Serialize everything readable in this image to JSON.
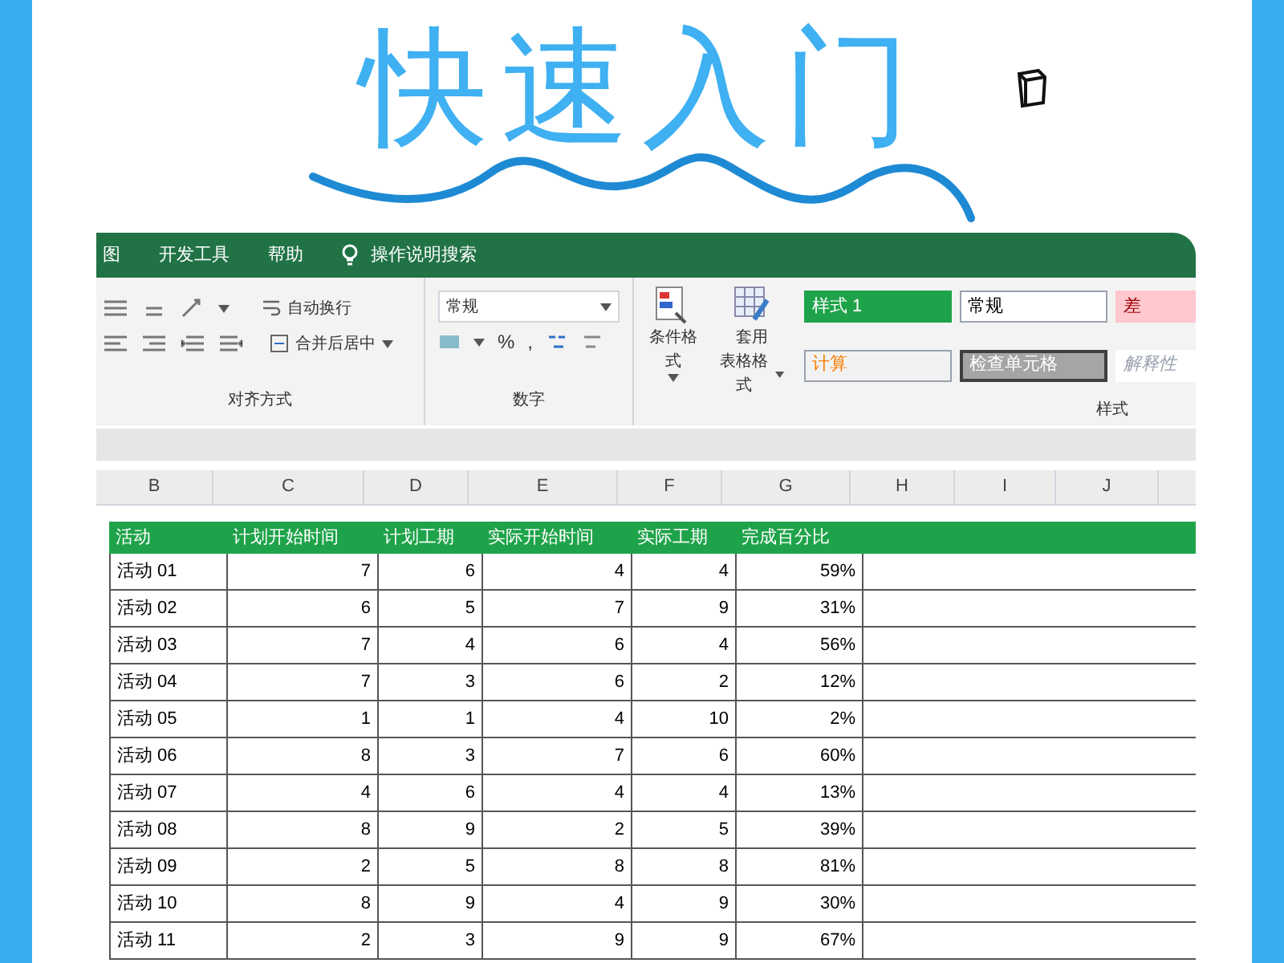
{
  "title": "快速入门",
  "ribbon_tabs": [
    "图",
    "开发工具",
    "帮助"
  ],
  "tell_me": "操作说明搜索",
  "alignment": {
    "wrap_text": "自动换行",
    "merge": "合并后居中",
    "label": "对齐方式"
  },
  "number": {
    "format": "常规",
    "symbols": [
      "%",
      ","
    ],
    "label": "数字"
  },
  "styles": {
    "conditional": "条件格式",
    "table_format": [
      "套用",
      "表格格式"
    ],
    "label": "样式",
    "cells": [
      {
        "text": "样式 1",
        "kind": "green"
      },
      {
        "text": "常规",
        "kind": "normal"
      },
      {
        "text": "差",
        "kind": "bad"
      },
      {
        "text": "计算",
        "kind": "calc"
      },
      {
        "text": "检查单元格",
        "kind": "check"
      },
      {
        "text": "解释性",
        "kind": "note"
      }
    ]
  },
  "column_letters": [
    "B",
    "C",
    "D",
    "E",
    "F",
    "G",
    "H",
    "I",
    "J"
  ],
  "table": {
    "columns": [
      "活动",
      "计划开始时间",
      "计划工期",
      "实际开始时间",
      "实际工期",
      "完成百分比"
    ],
    "rows": [
      [
        "活动 01",
        "7",
        "6",
        "4",
        "4",
        "59%"
      ],
      [
        "活动 02",
        "6",
        "5",
        "7",
        "9",
        "31%"
      ],
      [
        "活动 03",
        "7",
        "4",
        "6",
        "4",
        "56%"
      ],
      [
        "活动 04",
        "7",
        "3",
        "6",
        "2",
        "12%"
      ],
      [
        "活动 05",
        "1",
        "1",
        "4",
        "10",
        "2%"
      ],
      [
        "活动 06",
        "8",
        "3",
        "7",
        "6",
        "60%"
      ],
      [
        "活动 07",
        "4",
        "6",
        "4",
        "4",
        "13%"
      ],
      [
        "活动 08",
        "8",
        "9",
        "2",
        "5",
        "39%"
      ],
      [
        "活动 09",
        "2",
        "5",
        "8",
        "8",
        "81%"
      ],
      [
        "活动 10",
        "8",
        "9",
        "4",
        "9",
        "30%"
      ],
      [
        "活动 11",
        "2",
        "3",
        "9",
        "9",
        "67%"
      ]
    ]
  }
}
